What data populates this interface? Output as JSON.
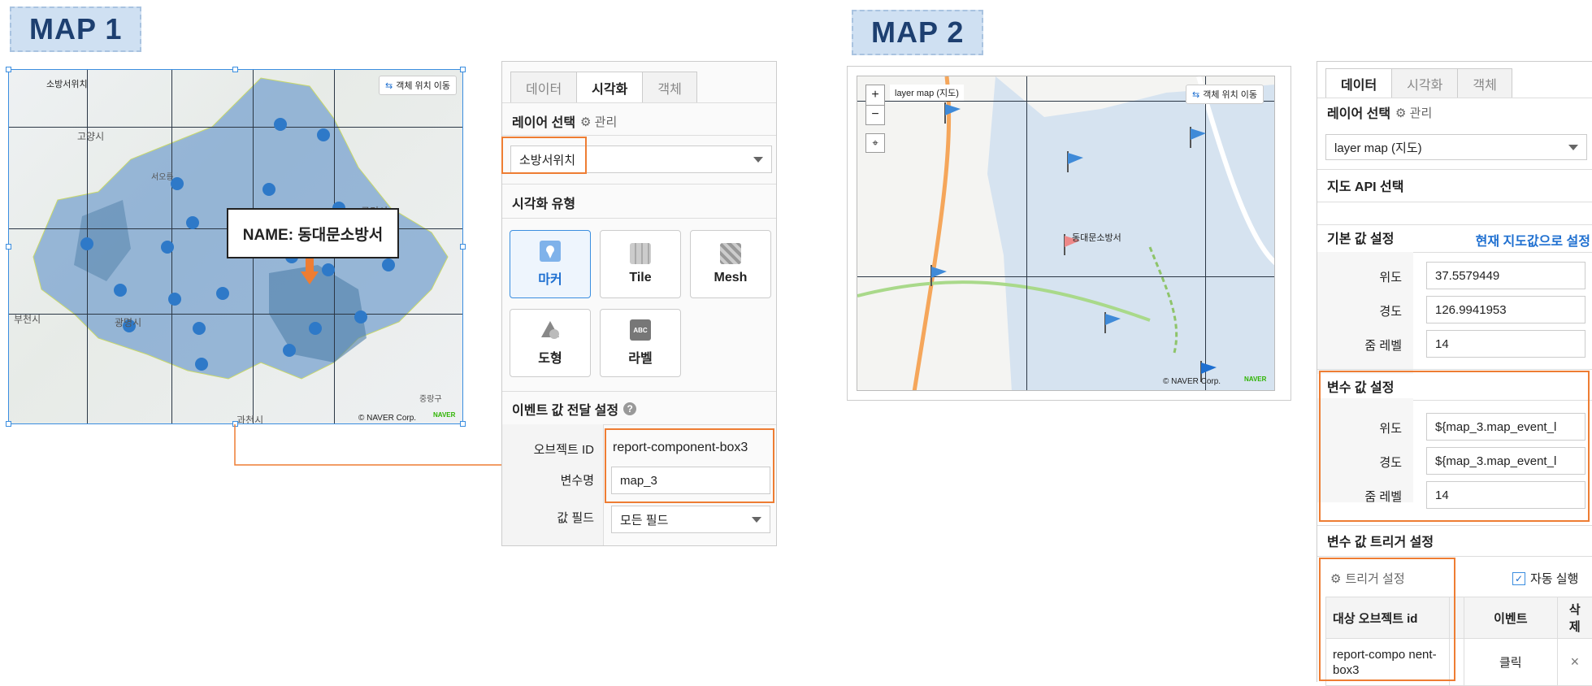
{
  "map1": {
    "badge": "MAP 1",
    "layer_label": "소방서위치",
    "move_button": "객체 위치 이동",
    "callout": "NAME: 동대문소방서",
    "copyright": "© NAVER Corp.",
    "naver": "NAVER",
    "place_labels": [
      "고양시",
      "부천시",
      "광명시",
      "과천시",
      "구리시",
      "서오릉",
      "중랑구"
    ]
  },
  "panel1": {
    "tabs": [
      "데이터",
      "시각화",
      "객체"
    ],
    "active_tab": "시각화",
    "layer_select_label": "레이어 선택",
    "manage_label": "관리",
    "layer_value": "소방서위치",
    "viz_type_label": "시각화 유형",
    "viz_buttons": [
      "마커",
      "Tile",
      "Mesh",
      "도형",
      "라벨"
    ],
    "viz_active": "마커",
    "event_label": "이벤트 값 전달 설정",
    "object_id_label": "오브젝트 ID",
    "object_id_value": "report-component-box3",
    "var_name_label": "변수명",
    "var_name_value": "map_3",
    "value_field_label": "값 필드",
    "value_field_value": "모든 필드"
  },
  "map2": {
    "badge": "MAP 2",
    "layer_label": "layer map (지도)",
    "move_button": "객체 위치 이동",
    "marker_label": "동대문소방서",
    "copyright": "© NAVER Corp.",
    "naver": "NAVER",
    "zoom_in": "+",
    "zoom_out": "−"
  },
  "panel2": {
    "tabs": [
      "데이터",
      "시각화",
      "객체"
    ],
    "active_tab": "데이터",
    "layer_select_label": "레이어 선택",
    "manage_label": "관리",
    "layer_value": "layer map (지도)",
    "api_label": "지도 API 선택",
    "default_label": "기본 값 설정",
    "set_current_link": "현재 지도값으로 설정",
    "lat_label": "위도",
    "lat_value": "37.5579449",
    "lng_label": "경도",
    "lng_value": "126.9941953",
    "zoom_label": "줌 레벨",
    "zoom_value": "14",
    "var_label": "변수 값 설정",
    "var_lat_value": "${map_3.map_event_l",
    "var_lng_value": "${map_3.map_event_l",
    "var_zoom_value": "14",
    "trigger_section": "변수 값 트리거 설정",
    "trigger_button": "트리거 설정",
    "auto_run": "자동 실행",
    "table_headers": [
      "대상 오브젝트 id",
      "이벤트",
      "삭제"
    ],
    "table_row": {
      "object": "report-compo nent-box3",
      "event": "클릭",
      "delete": "×"
    }
  }
}
